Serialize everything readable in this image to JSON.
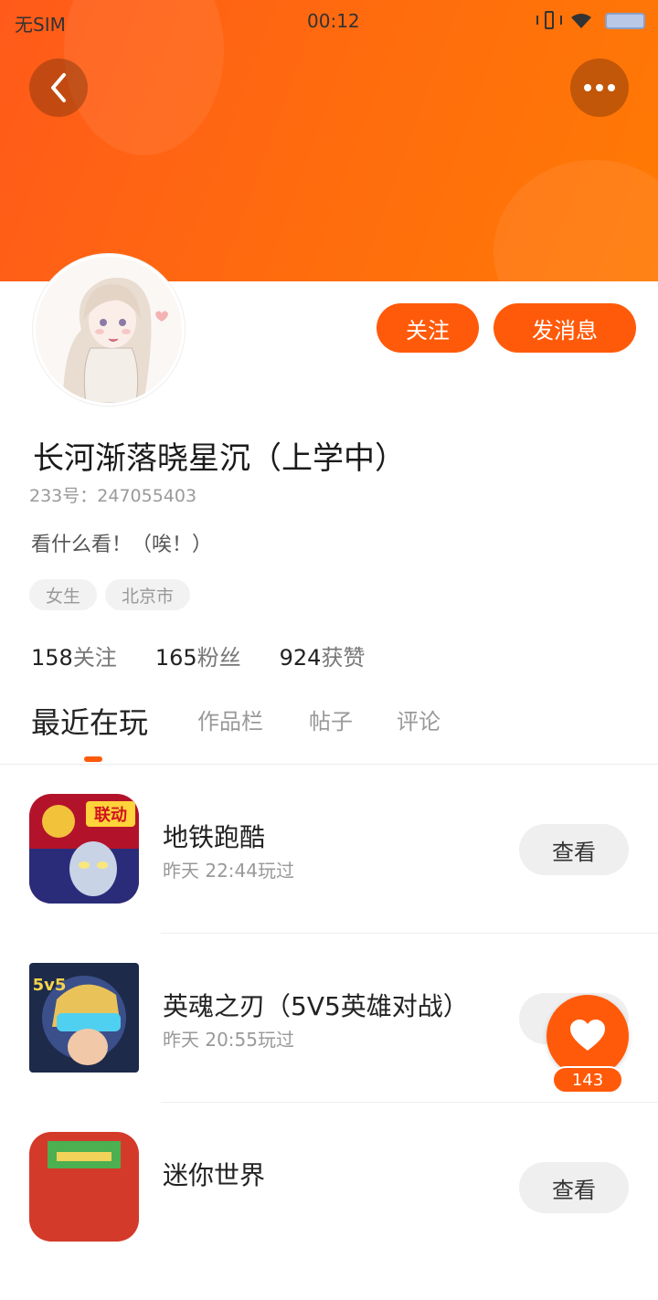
{
  "status_bar": {
    "carrier": "无SIM",
    "time": "00:12"
  },
  "profile": {
    "name": "长河渐落晓星沉（上学中）",
    "uid_label": "233号：",
    "uid_value": "247055403",
    "bio": "看什么看！（唉！）",
    "tags": [
      "女生",
      "北京市"
    ],
    "follow_label": "关注",
    "message_label": "发消息",
    "stats": [
      {
        "value": "158",
        "label": "关注"
      },
      {
        "value": "165",
        "label": "粉丝"
      },
      {
        "value": "924",
        "label": "获赞"
      }
    ]
  },
  "tabs": [
    "最近在玩",
    "作品栏",
    "帖子",
    "评论"
  ],
  "active_tab": "最近在玩",
  "games": [
    {
      "title": "地铁跑酷",
      "time": "昨天 22:44玩过",
      "button": "查看",
      "badge": "联动"
    },
    {
      "title": "英魂之刃（5V5英雄对战）",
      "time": "昨天 20:55玩过",
      "button": "查看",
      "badge": "5v5"
    },
    {
      "title": "迷你世界",
      "time": "",
      "button": "查看",
      "badge": ""
    }
  ],
  "likes": {
    "count": "143"
  },
  "colors": {
    "accent": "#ff5a0a",
    "header": "#ff6d0d"
  },
  "icons": [
    "back-arrow-icon",
    "more-dots-icon",
    "heart-icon",
    "vibrate-icon",
    "wifi-icon",
    "battery-icon"
  ]
}
